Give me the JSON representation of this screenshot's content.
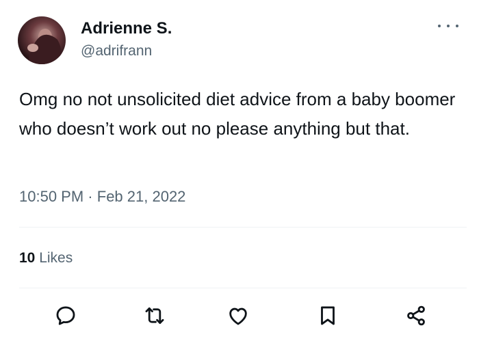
{
  "tweet": {
    "author": {
      "display_name": "Adrienne S.",
      "handle": "@adrifrann"
    },
    "text": "Omg no not unsolicited diet advice from a baby boomer who doesn’t work out no please anything but that.",
    "time": "10:50 PM",
    "separator": "·",
    "date": "Feb 21, 2022",
    "likes_count": "10",
    "likes_label": "Likes"
  },
  "actions": [
    {
      "icon": "reply-icon"
    },
    {
      "icon": "retweet-icon"
    },
    {
      "icon": "like-icon"
    },
    {
      "icon": "bookmark-icon"
    },
    {
      "icon": "share-icon"
    }
  ],
  "colors": {
    "text": "#0f1419",
    "secondary": "#536471",
    "divider": "#eff3f4",
    "icon": "#0f1419"
  }
}
